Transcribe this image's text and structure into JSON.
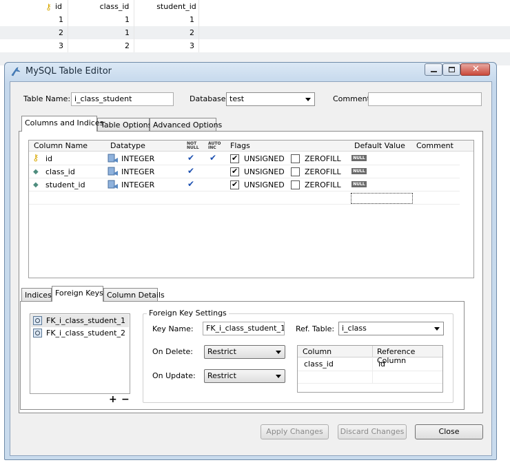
{
  "result_grid": {
    "headers": [
      "id",
      "class_id",
      "student_id"
    ],
    "rows": [
      [
        "1",
        "1",
        "1"
      ],
      [
        "2",
        "1",
        "2"
      ],
      [
        "3",
        "2",
        "3"
      ]
    ]
  },
  "window": {
    "title": "MySQL Table Editor",
    "buttons": {
      "minimize": "minimize",
      "maximize": "maximize",
      "close": "close"
    }
  },
  "form": {
    "table_name_label": "Table Name:",
    "table_name_value": "i_class_student",
    "database_label": "Database:",
    "database_value": "test",
    "comment_label": "Comment:",
    "comment_value": ""
  },
  "main_tabs": [
    "Columns and Indices",
    "Table Options",
    "Advanced Options"
  ],
  "columns_grid": {
    "headers": {
      "name": "Column Name",
      "datatype": "Datatype",
      "not_null_1": "NOT",
      "not_null_2": "NULL",
      "auto_inc_1": "AUTO",
      "auto_inc_2": "INC",
      "flags": "Flags",
      "default": "Default Value",
      "comment": "Comment"
    },
    "rows": [
      {
        "name": "id",
        "type": "INTEGER",
        "not_null": true,
        "auto_inc": true,
        "unsigned": true,
        "zerofill": false,
        "default": "NULL",
        "icon": "key-icon"
      },
      {
        "name": "class_id",
        "type": "INTEGER",
        "not_null": true,
        "auto_inc": false,
        "unsigned": true,
        "zerofill": false,
        "default": "NULL",
        "icon": "diamond-icon"
      },
      {
        "name": "student_id",
        "type": "INTEGER",
        "not_null": true,
        "auto_inc": false,
        "unsigned": true,
        "zerofill": false,
        "default": "NULL",
        "icon": "diamond-icon"
      }
    ],
    "flag_unsigned": "UNSIGNED",
    "flag_zerofill": "ZEROFILL"
  },
  "sub_tabs": [
    "Indices",
    "Foreign Keys",
    "Column Details"
  ],
  "foreign_keys": {
    "list": [
      "FK_i_class_student_1",
      "FK_i_class_student_2"
    ],
    "add_label": "+",
    "remove_label": "−",
    "settings_title": "Foreign Key Settings",
    "key_name_label": "Key Name:",
    "key_name_value": "FK_i_class_student_1",
    "ref_table_label": "Ref. Table:",
    "ref_table_value": "i_class",
    "on_delete_label": "On Delete:",
    "on_delete_value": "Restrict",
    "on_update_label": "On Update:",
    "on_update_value": "Restrict",
    "map_headers": [
      "Column",
      "Reference Column"
    ],
    "map_rows": [
      [
        "class_id",
        "id"
      ]
    ]
  },
  "footer": {
    "apply": "Apply Changes",
    "discard": "Discard Changes",
    "close": "Close"
  }
}
